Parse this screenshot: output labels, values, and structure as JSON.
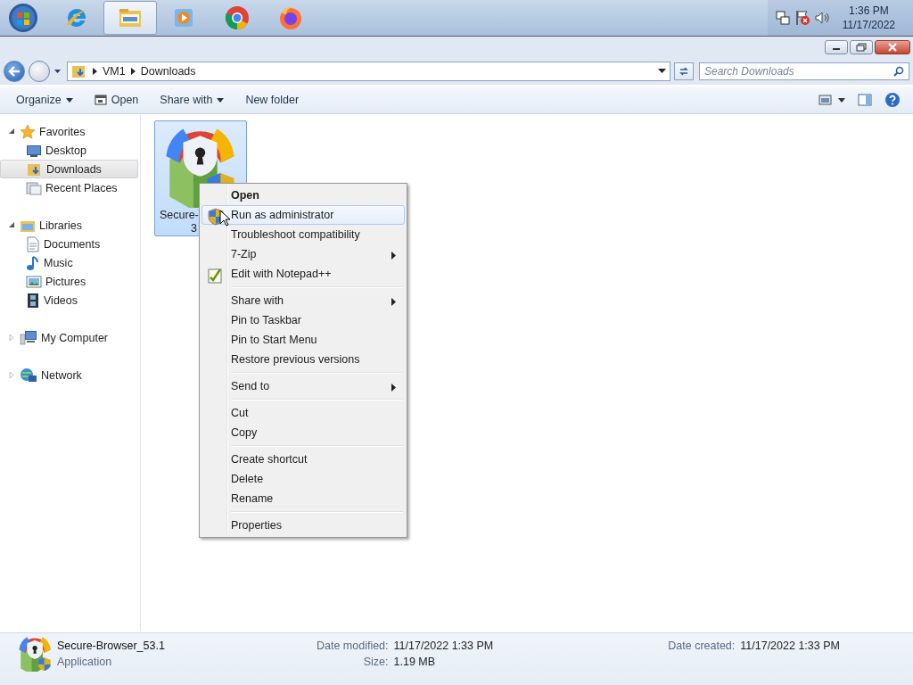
{
  "taskbar": {
    "apps": [
      {
        "kind": "ie",
        "selected": false
      },
      {
        "kind": "explorer",
        "selected": true
      },
      {
        "kind": "media",
        "selected": false
      },
      {
        "kind": "chrome",
        "selected": false
      },
      {
        "kind": "firefox",
        "selected": false
      }
    ],
    "clock": {
      "time": "1:36 PM",
      "date": "11/17/2022"
    }
  },
  "address": {
    "path": [
      "VM1",
      "Downloads"
    ]
  },
  "search": {
    "placeholder": "Search Downloads"
  },
  "toolbar": [
    {
      "label": "Organize",
      "kind": "dropdown"
    },
    {
      "label": "Open",
      "kind": "icon"
    },
    {
      "label": "Share with",
      "kind": "dropdown"
    },
    {
      "label": "New folder",
      "kind": "plain"
    }
  ],
  "sidebar": {
    "groups": [
      {
        "label": "Favorites",
        "kind": "star",
        "expanded": true,
        "children": [
          {
            "label": "Desktop",
            "kind": "desktop",
            "selected": false
          },
          {
            "label": "Downloads",
            "kind": "downloads",
            "selected": true
          },
          {
            "label": "Recent Places",
            "kind": "recent",
            "selected": false
          }
        ]
      },
      {
        "label": "Libraries",
        "kind": "library",
        "expanded": true,
        "children": [
          {
            "label": "Documents",
            "kind": "documents",
            "selected": false
          },
          {
            "label": "Music",
            "kind": "music",
            "selected": false
          },
          {
            "label": "Pictures",
            "kind": "pictures",
            "selected": false
          },
          {
            "label": "Videos",
            "kind": "videos",
            "selected": false
          }
        ]
      },
      {
        "label": "My Computer",
        "kind": "computer",
        "expanded": false
      },
      {
        "label": "Network",
        "kind": "network",
        "expanded": false
      }
    ]
  },
  "files": [
    {
      "lines": [
        "Secure-",
        "3"
      ],
      "selected": true
    }
  ],
  "context_menu": {
    "items": [
      {
        "kind": "item",
        "label": "Open",
        "default": true,
        "highlighted": false,
        "submenu": false
      },
      {
        "kind": "shield",
        "label": "Run as administrator",
        "default": false,
        "highlighted": true,
        "submenu": false
      },
      {
        "kind": "item",
        "label": "Troubleshoot compatibility",
        "default": false,
        "highlighted": false,
        "submenu": false
      },
      {
        "kind": "item",
        "label": "7-Zip",
        "default": false,
        "highlighted": false,
        "submenu": true
      },
      {
        "kind": "notepad",
        "label": "Edit with Notepad++",
        "default": false,
        "highlighted": false,
        "submenu": false
      },
      {
        "kind": "separator"
      },
      {
        "kind": "item",
        "label": "Share with",
        "default": false,
        "highlighted": false,
        "submenu": true
      },
      {
        "kind": "item",
        "label": "Pin to Taskbar",
        "default": false,
        "highlighted": false,
        "submenu": false
      },
      {
        "kind": "item",
        "label": "Pin to Start Menu",
        "default": false,
        "highlighted": false,
        "submenu": false
      },
      {
        "kind": "item",
        "label": "Restore previous versions",
        "default": false,
        "highlighted": false,
        "submenu": false
      },
      {
        "kind": "separator"
      },
      {
        "kind": "item",
        "label": "Send to",
        "default": false,
        "highlighted": false,
        "submenu": true
      },
      {
        "kind": "separator"
      },
      {
        "kind": "item",
        "label": "Cut",
        "default": false,
        "highlighted": false,
        "submenu": false
      },
      {
        "kind": "item",
        "label": "Copy",
        "default": false,
        "highlighted": false,
        "submenu": false
      },
      {
        "kind": "separator"
      },
      {
        "kind": "item",
        "label": "Create shortcut",
        "default": false,
        "highlighted": false,
        "submenu": false
      },
      {
        "kind": "item",
        "label": "Delete",
        "default": false,
        "highlighted": false,
        "submenu": false
      },
      {
        "kind": "item",
        "label": "Rename",
        "default": false,
        "highlighted": false,
        "submenu": false
      },
      {
        "kind": "separator"
      },
      {
        "kind": "item",
        "label": "Properties",
        "default": false,
        "highlighted": false,
        "submenu": false
      }
    ]
  },
  "details": {
    "name": "Secure-Browser_53.1",
    "type": "Application",
    "fields": [
      {
        "label": "Date modified:",
        "value": "11/17/2022 1:33 PM"
      },
      {
        "label": "Date created:",
        "value": "11/17/2022 1:33 PM"
      },
      {
        "label": "Size:",
        "value": "1.19 MB"
      }
    ]
  }
}
